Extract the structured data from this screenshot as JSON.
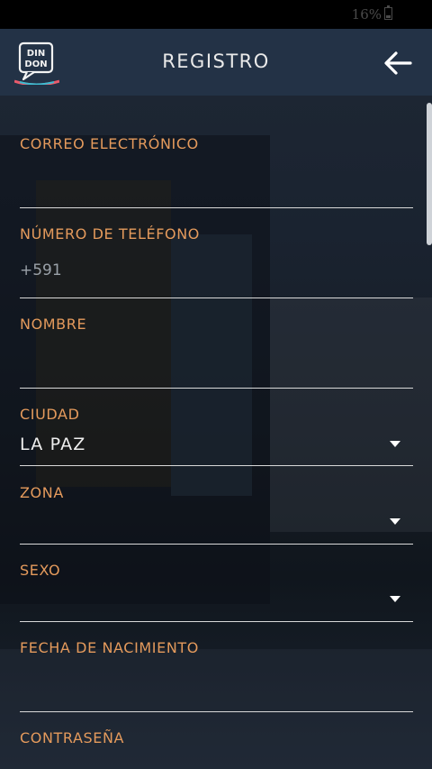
{
  "status_bar": {
    "battery_text": "16%"
  },
  "header": {
    "title": "REGISTRO",
    "logo_text_top": "DIN",
    "logo_text_bottom": "DON"
  },
  "form": {
    "email": {
      "label": "CORREO ELECTRÓNICO",
      "value": ""
    },
    "phone": {
      "label": "NÚMERO DE TELÉFONO",
      "placeholder": "+591"
    },
    "name": {
      "label": "NOMBRE",
      "value": ""
    },
    "city": {
      "label": "CIUDAD",
      "value": "LA PAZ"
    },
    "zone": {
      "label": "ZONA",
      "value": ""
    },
    "sex": {
      "label": "SEXO",
      "value": ""
    },
    "birthdate": {
      "label": "FECHA DE NACIMIENTO",
      "value": ""
    },
    "password": {
      "label": "CONTRASEÑA",
      "value": ""
    }
  },
  "colors": {
    "accent": "#e49a5c",
    "appbar": "#233246"
  }
}
